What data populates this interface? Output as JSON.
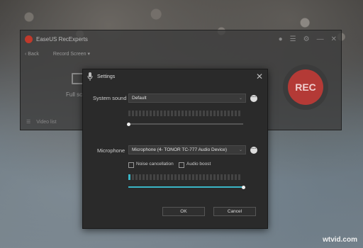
{
  "app": {
    "title": "EaseUS RecExperts",
    "back_label": "Back",
    "mode_label": "Record Screen",
    "fullscreen_label": "Full sc",
    "rec_label": "REC",
    "bottom_label": "Video list"
  },
  "dialog": {
    "title": "Settings",
    "system_sound": {
      "label": "System sound",
      "value": "Default",
      "level": 0.0
    },
    "microphone": {
      "label": "Microphone",
      "value": "Microphone (4- TONOR TC-777 Audio Device)",
      "level": 1.0
    },
    "noise_cancellation_label": "Noise cancellation",
    "audio_boost_label": "Audio boost",
    "ok_label": "OK",
    "cancel_label": "Cancel"
  },
  "watermark": "wtvid.com",
  "colors": {
    "accent": "#3ab5c6",
    "rec": "#b43a36"
  }
}
